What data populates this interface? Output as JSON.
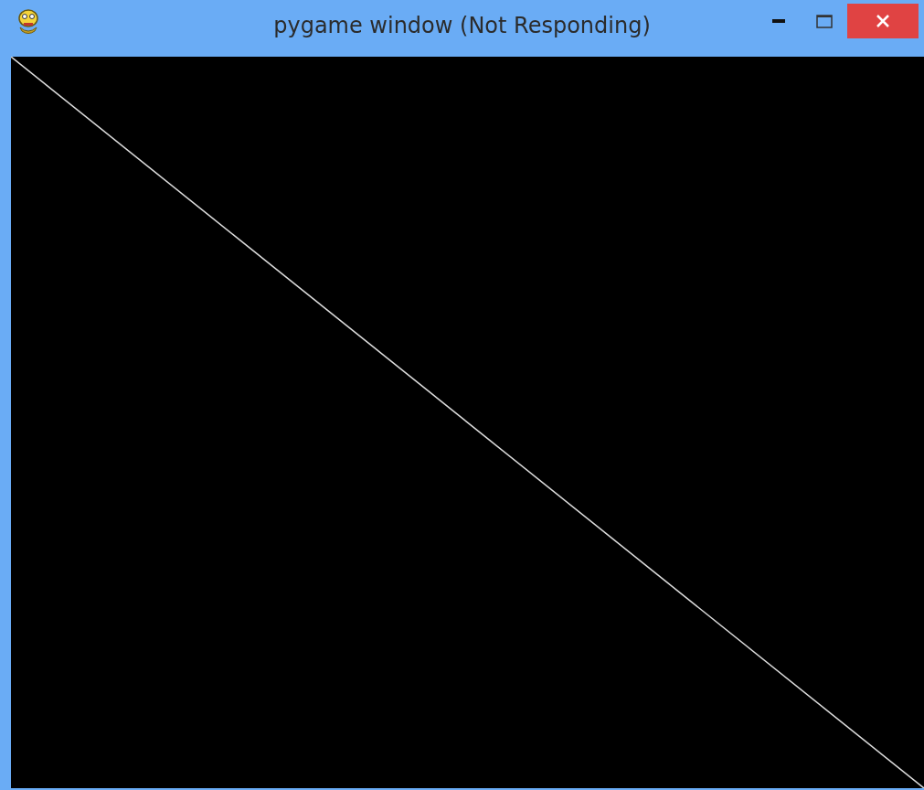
{
  "window": {
    "title": "pygame window (Not Responding)"
  }
}
